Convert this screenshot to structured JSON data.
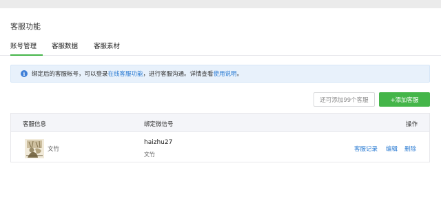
{
  "page": {
    "title": "客服功能"
  },
  "tabs": [
    {
      "label": "账号管理",
      "active": true
    },
    {
      "label": "客服数据",
      "active": false
    },
    {
      "label": "客服素材",
      "active": false
    }
  ],
  "notice": {
    "text_1": "绑定后的客服帐号，可以登录",
    "link_1": "在线客服功能",
    "text_2": "，进行客服沟通。详情查看",
    "link_2": "使用说明",
    "text_3": "。",
    "icon": "info-icon",
    "color": "#e8f1fb"
  },
  "actions": {
    "quota_label": "还可添加99个客服",
    "add_label": "+添加客服",
    "add_color": "#44b549"
  },
  "table": {
    "headers": {
      "info": "客服信息",
      "wechat": "绑定微信号",
      "ops": "操作"
    },
    "rows": [
      {
        "name": "文竹",
        "wechat_id": "haizhu27",
        "wechat_nick": "文竹",
        "actions": [
          "客服记录",
          "编辑",
          "删除"
        ]
      }
    ]
  },
  "colors": {
    "link": "#2a7bd3",
    "accent": "#44b549"
  }
}
